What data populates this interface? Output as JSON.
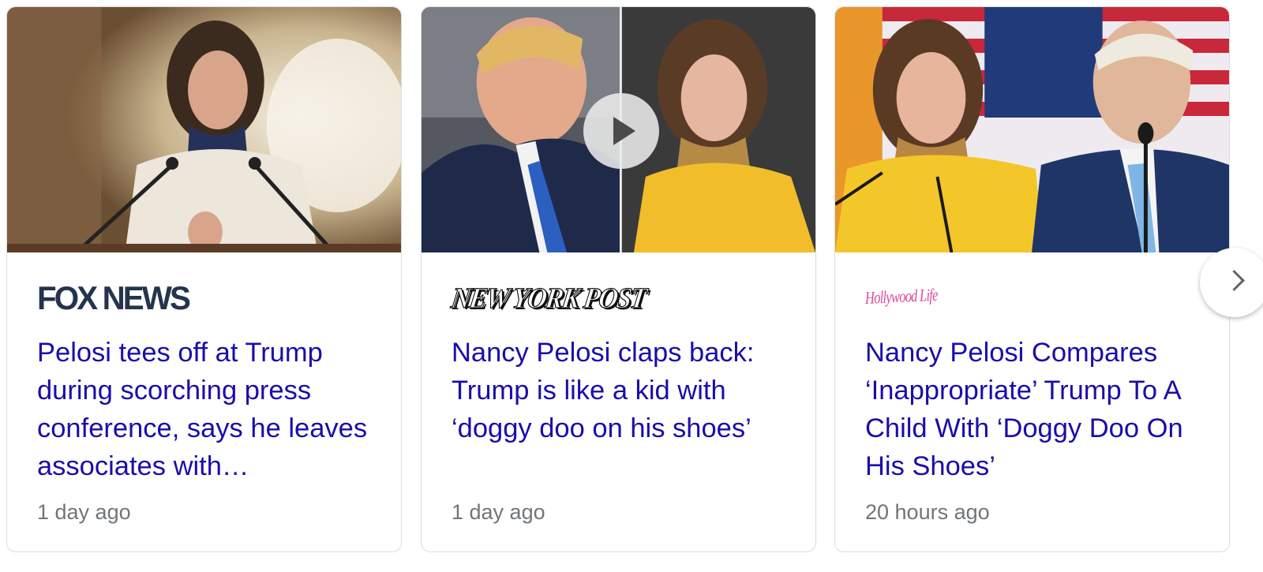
{
  "cards": [
    {
      "source": "FOX NEWS",
      "headline": "Pelosi tees off at Trump during scorching press conference, says he leaves associates with…",
      "time": "1 day ago",
      "has_video": false
    },
    {
      "source": "NEW YORK POST",
      "headline": "Nancy Pelosi claps back: Trump is like a kid with ‘doggy doo on his shoes’",
      "time": "1 day ago",
      "has_video": true
    },
    {
      "source": "Hollywood Life",
      "headline": "Nancy Pelosi Compares ‘Inappropriate’ Trump To A Child With ‘Doggy Doo On His Shoes’",
      "time": "20 hours ago",
      "has_video": false
    }
  ],
  "colors": {
    "headline_link": "#1a0dab",
    "timestamp": "#70757a",
    "card_border": "#dadce0",
    "fox_logo": "#24344d",
    "hollywoodlife_logo": "#e0469c"
  },
  "icons": {
    "play": "play-icon",
    "next": "chevron-right-icon"
  }
}
